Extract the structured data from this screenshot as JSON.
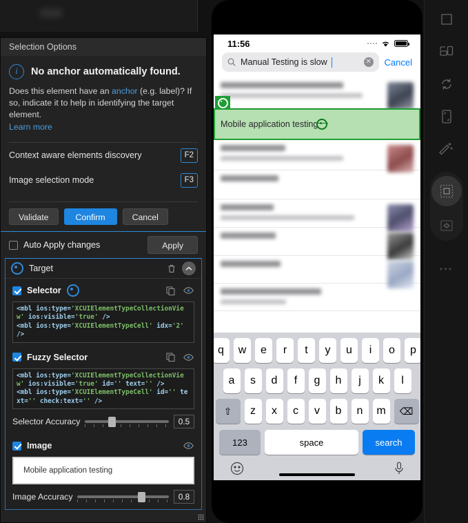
{
  "panel": {
    "title": "Selection Options",
    "info": {
      "icon": "info-icon",
      "heading": "No anchor automatically found.",
      "body_part1": "Does this element have an ",
      "anchor_link": "anchor",
      "body_part2": " (e.g. label)? If so, indicate it to help in identifying the target element.",
      "learn_more": "Learn more"
    },
    "shortcuts": [
      {
        "label": "Context aware elements discovery",
        "key": "F2"
      },
      {
        "label": "Image selection mode",
        "key": "F3"
      }
    ],
    "buttons": {
      "validate": "Validate",
      "confirm": "Confirm",
      "cancel": "Cancel",
      "apply": "Apply"
    },
    "auto_apply": {
      "label": "Auto Apply changes",
      "checked": false
    },
    "target": {
      "title": "Target",
      "selector": {
        "title": "Selector",
        "checked": true,
        "code": "<mbl ios:type='XCUIElementTypeCollectionView' ios:visible='true' />\n<mbl ios:type='XCUIElementTypeCell' idx='2' />"
      },
      "fuzzy_selector": {
        "title": "Fuzzy Selector",
        "checked": true,
        "code": "<mbl ios:type='XCUIElementTypeCollectionView' ios:visible='true' id='' text='' />\n<mbl ios:type='XCUIElementTypeCell' id='' text='' check:text='' />"
      },
      "selector_accuracy": {
        "label": "Selector Accuracy",
        "value": "0.5"
      },
      "image": {
        "title": "Image",
        "checked": true,
        "preview_text": "Mobile application testing"
      },
      "image_accuracy": {
        "label": "Image Accuracy",
        "value": "0.8"
      }
    }
  },
  "phone": {
    "status": {
      "time": "11:56"
    },
    "search": {
      "value": "Manual Testing is slow",
      "cancel": "Cancel",
      "search_icon": "magnifier-icon",
      "clear_icon": "clear-icon"
    },
    "highlight": {
      "label": "Mobile application testing"
    },
    "keyboard": {
      "row1": [
        "q",
        "w",
        "e",
        "r",
        "t",
        "y",
        "u",
        "i",
        "o",
        "p"
      ],
      "row2": [
        "a",
        "s",
        "d",
        "f",
        "g",
        "h",
        "j",
        "k",
        "l"
      ],
      "row3": [
        "z",
        "x",
        "c",
        "v",
        "b",
        "n",
        "m"
      ],
      "shift": "⇧",
      "backspace": "⌫",
      "numbers": "123",
      "space": "space",
      "search": "search",
      "emoji": "emoji-icon",
      "mic": "microphone-icon"
    }
  },
  "toolbar": {
    "items": [
      {
        "name": "square-icon"
      },
      {
        "name": "device-rotate-icon"
      },
      {
        "name": "refresh-icon"
      },
      {
        "name": "device-frame-icon"
      },
      {
        "name": "magic-wand-icon"
      },
      {
        "name": "element-select-icon"
      },
      {
        "name": "crop-select-icon"
      }
    ],
    "more": "•••"
  },
  "colors": {
    "accent_blue": "#1e85e0",
    "highlight_green": "#b6dfb2",
    "highlight_border": "#1e9e34",
    "panel_bg": "#232323",
    "ios_blue": "#007aff"
  }
}
